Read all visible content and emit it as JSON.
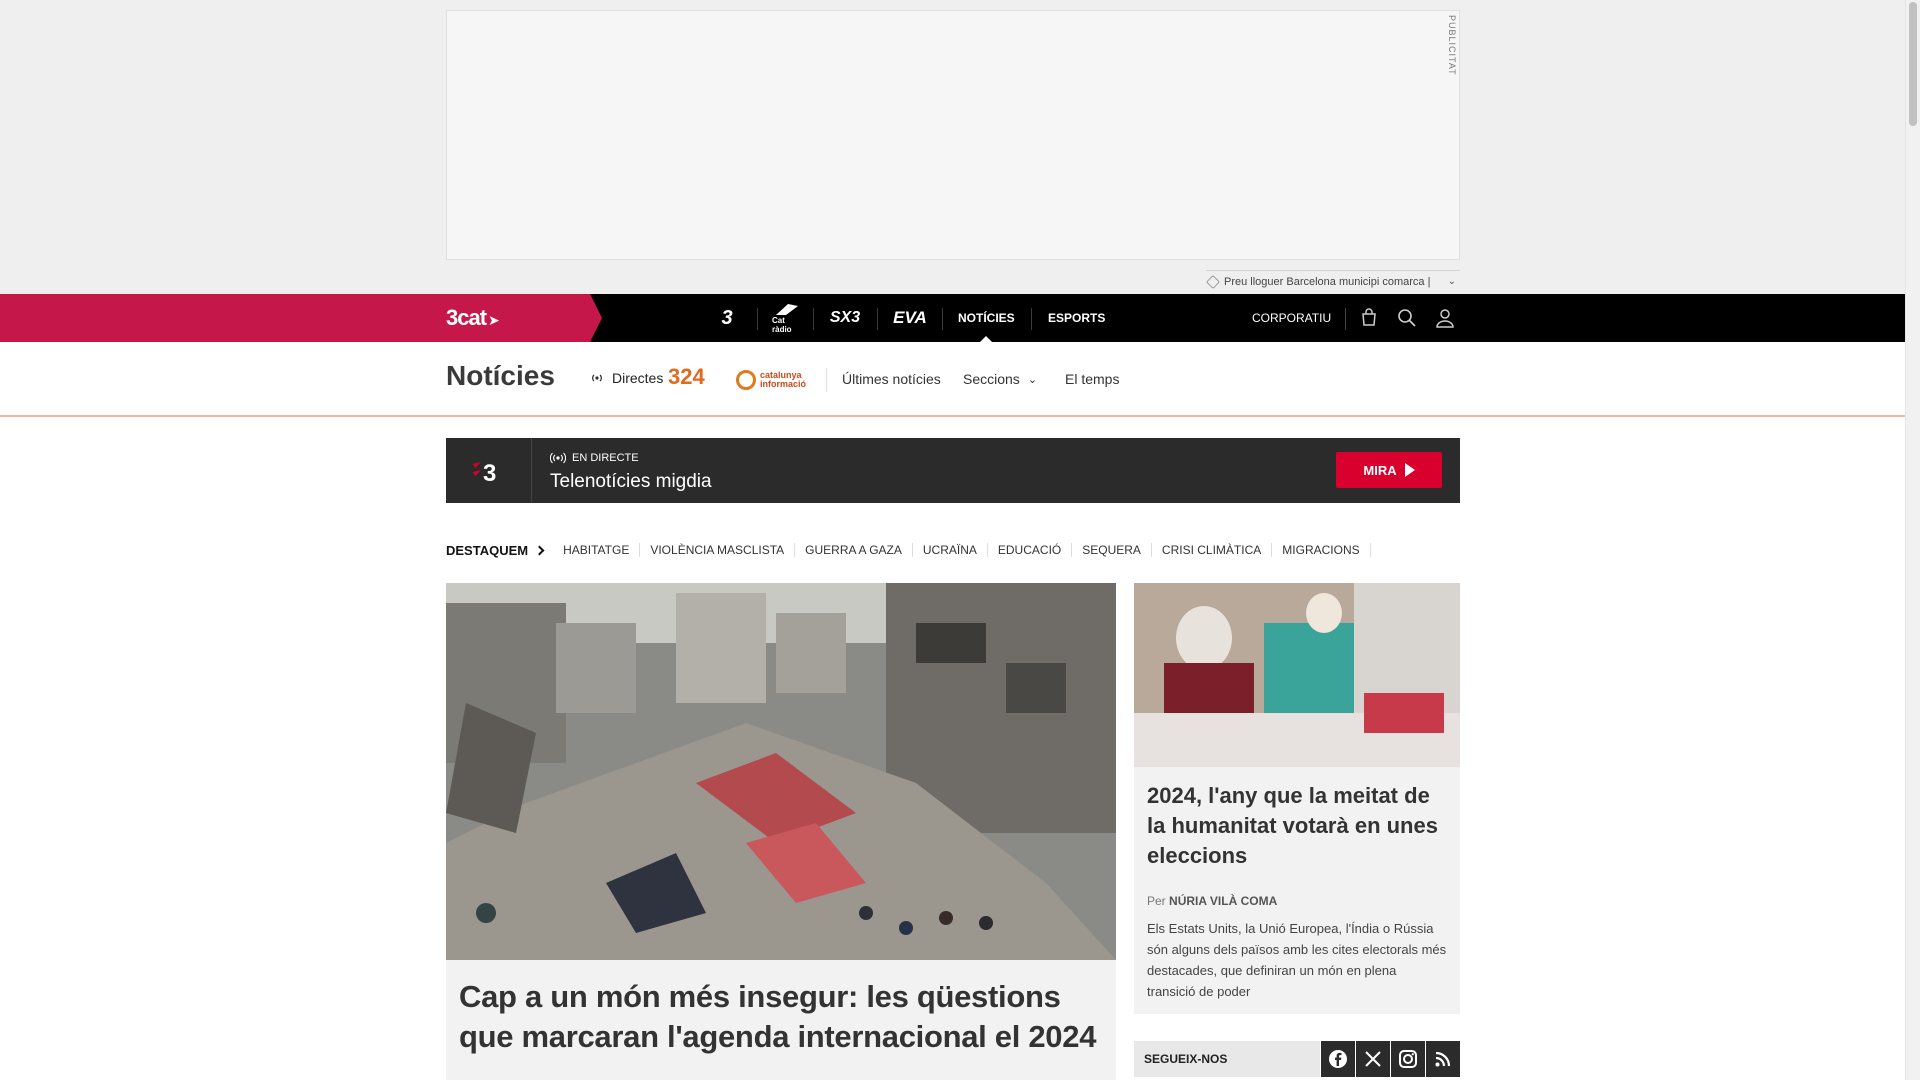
{
  "ad": {
    "label": "PUBLICITAT",
    "search_text": "Preu lloguer Barcelona municipi comarca |"
  },
  "topnav": {
    "brand": "3cat",
    "channels": [
      "3",
      "Cat ràdio",
      "SX3",
      "EVA"
    ],
    "links": [
      {
        "label": "NOTÍCIES",
        "active": true
      },
      {
        "label": "ESPORTS",
        "active": false
      }
    ],
    "corporate": "CORPORATIU",
    "icons": [
      "shop-icon",
      "search-icon",
      "user-icon"
    ]
  },
  "subheader": {
    "title": "Notícies",
    "directes": "Directes",
    "logo_324": "324",
    "logo_ci": [
      "catalunya",
      "informació"
    ],
    "links": [
      "Últimes notícies",
      "Seccions",
      "El temps"
    ]
  },
  "live": {
    "logo": "3",
    "tag": "EN DIRECTE",
    "title": "Telenotícies migdia",
    "button": "MIRA"
  },
  "destaquem": {
    "label": "DESTAQUEM",
    "tags": [
      "HABITATGE",
      "VIOLÈNCIA MASCLISTA",
      "GUERRA A GAZA",
      "UCRAÏNA",
      "EDUCACIÓ",
      "SEQUERA",
      "CRISI CLIMÀTICA",
      "MIGRACIONS"
    ]
  },
  "main_article": {
    "title": "Cap a un món més insegur: les qüestions que marcaran l'agenda internacional el 2024"
  },
  "side_article": {
    "title": "2024, l'any que la meitat de la humanitat votarà en unes eleccions",
    "by_prefix": "Per",
    "author": "NÚRIA VILÀ COMA",
    "description": "Els Estats Units, la Unió Europea, l'Índia o Rússia són alguns dels països amb les cites electorals més destacades, que definiran un món en plena transició de poder"
  },
  "social": {
    "label": "SEGUEIX-NOS",
    "icons": [
      "facebook-icon",
      "x-icon",
      "instagram-icon",
      "rss-icon"
    ]
  },
  "colors": {
    "brand_red": "#c6174b",
    "button_red": "#d9002e",
    "nav_black": "#000000",
    "live_bg": "#2b2b2b",
    "accent_orange": "#e06b1e"
  }
}
